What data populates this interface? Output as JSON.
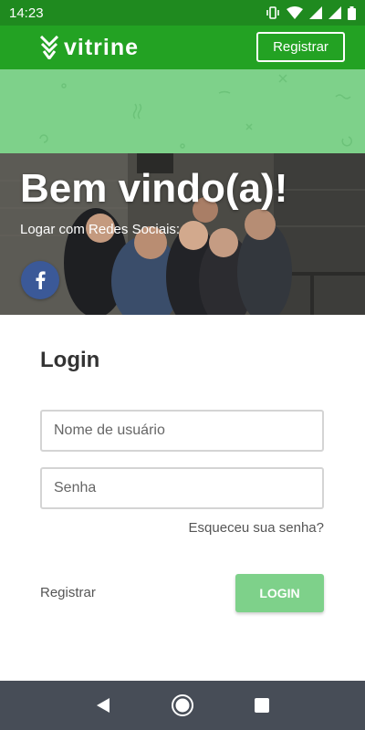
{
  "status_bar": {
    "time": "14:23",
    "icons": [
      "vibrate-icon",
      "wifi-icon",
      "signal-icon",
      "signal-icon",
      "battery-icon"
    ]
  },
  "header": {
    "logo_text": "vitrine",
    "register_label": "Registrar",
    "background_color": "#23a223"
  },
  "hero": {
    "title": "Bem vindo(a)!",
    "social_label": "Logar com Redes Sociais:",
    "social_buttons": [
      "facebook-icon"
    ]
  },
  "login": {
    "title": "Login",
    "username_placeholder": "Nome de usuário",
    "username_value": "",
    "password_placeholder": "Senha",
    "password_value": "",
    "forgot_password": "Esqueceu sua senha?",
    "register_link": "Registrar",
    "login_button": "LOGIN",
    "accent_color": "#7ed18a"
  },
  "nav_bar": {
    "buttons": [
      "back-icon",
      "home-icon",
      "recents-icon"
    ]
  }
}
